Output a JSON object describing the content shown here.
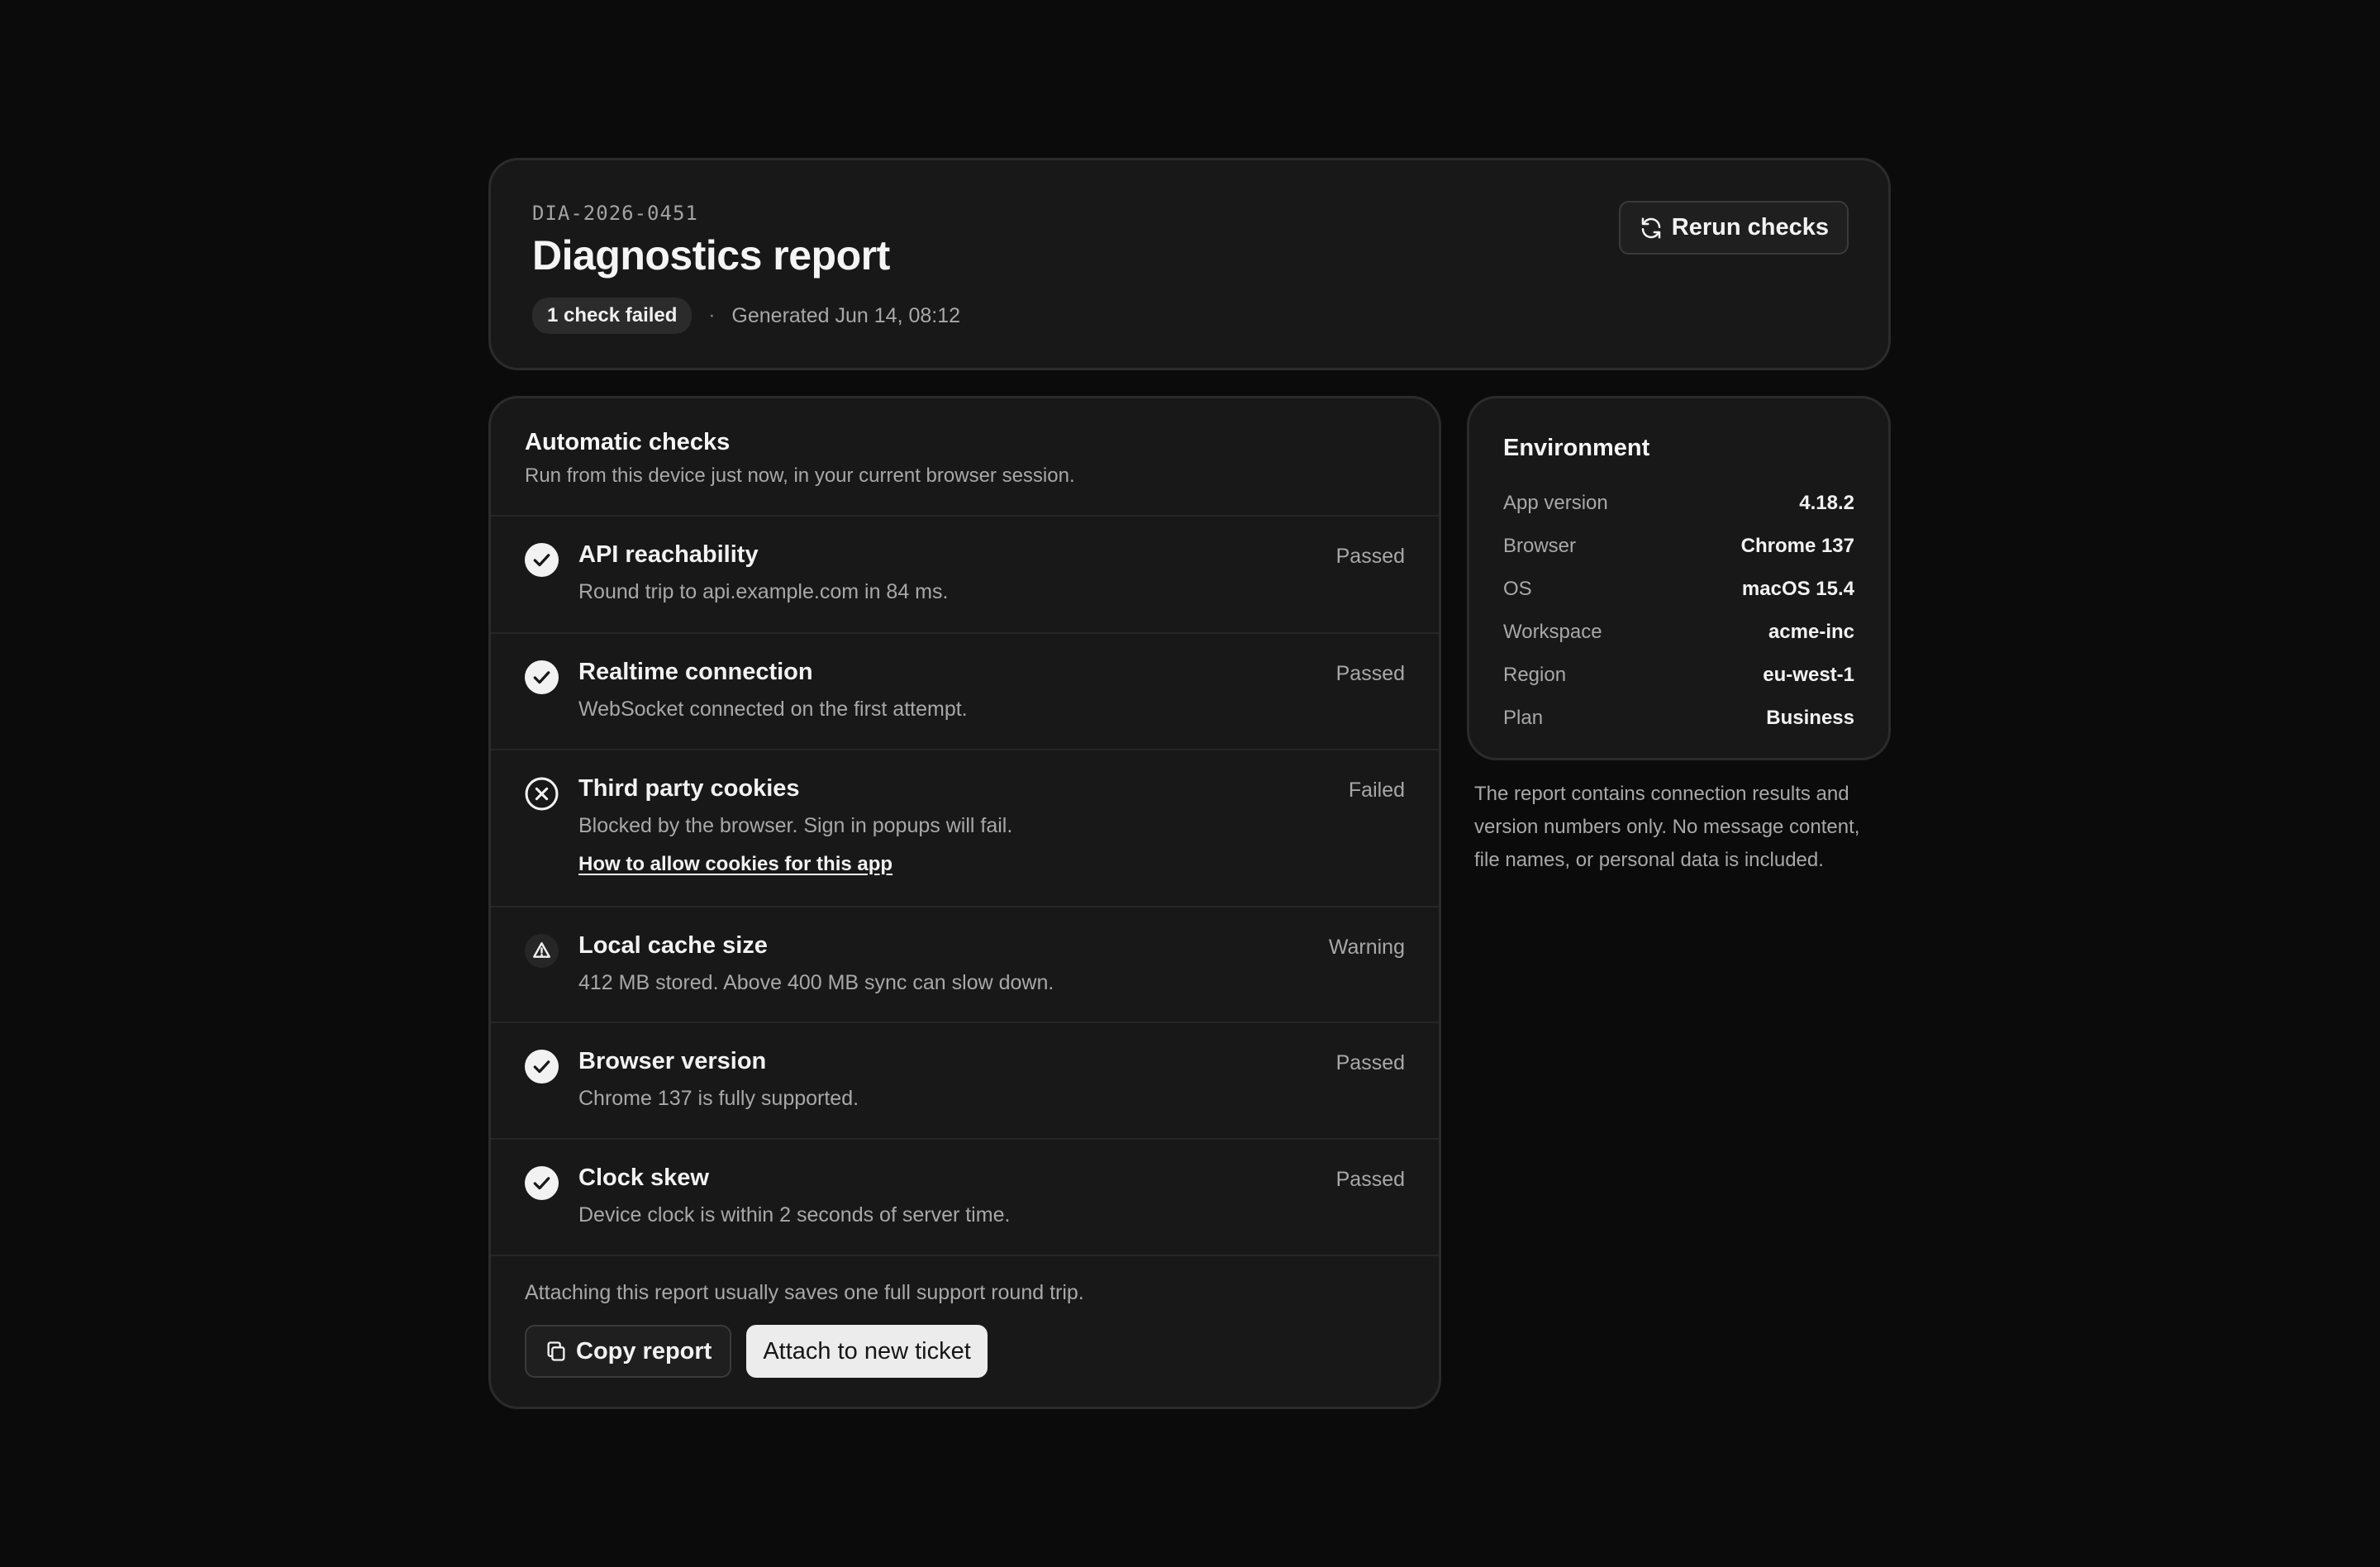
{
  "header": {
    "report_id": "DIA-2026-0451",
    "title": "Diagnostics report",
    "badge": "1 check failed",
    "separator": "·",
    "generated": "Generated Jun 14, 08:12",
    "rerun_label": "Rerun checks",
    "rerun_icon": "refresh-icon"
  },
  "checks": {
    "title": "Automatic checks",
    "subtitle": "Run from this device just now, in your current browser session.",
    "items": [
      {
        "name": "API reachability",
        "desc": "Round trip to api.example.com in 84 ms.",
        "status": "Passed",
        "icon": "check-circle-icon"
      },
      {
        "name": "Realtime connection",
        "desc": "WebSocket connected on the first attempt.",
        "status": "Passed",
        "icon": "check-circle-icon"
      },
      {
        "name": "Third party cookies",
        "desc": "Blocked by the browser. Sign in popups will fail.",
        "status": "Failed",
        "icon": "x-circle-icon",
        "link": "How to allow cookies for this app"
      },
      {
        "name": "Local cache size",
        "desc": "412 MB stored. Above 400 MB sync can slow down.",
        "status": "Warning",
        "icon": "warning-triangle-icon"
      },
      {
        "name": "Browser version",
        "desc": "Chrome 137 is fully supported.",
        "status": "Passed",
        "icon": "check-circle-icon"
      },
      {
        "name": "Clock skew",
        "desc": "Device clock is within 2 seconds of server time.",
        "status": "Passed",
        "icon": "check-circle-icon"
      }
    ],
    "footer_note": "Attaching this report usually saves one full support round trip.",
    "copy_label": "Copy report",
    "copy_icon": "copy-icon",
    "attach_label": "Attach to new ticket"
  },
  "environment": {
    "title": "Environment",
    "rows": [
      {
        "key": "App version",
        "value": "4.18.2"
      },
      {
        "key": "Browser",
        "value": "Chrome 137"
      },
      {
        "key": "OS",
        "value": "macOS 15.4"
      },
      {
        "key": "Workspace",
        "value": "acme-inc"
      },
      {
        "key": "Region",
        "value": "eu-west-1"
      },
      {
        "key": "Plan",
        "value": "Business"
      }
    ]
  },
  "privacy_note": "The report contains connection results and version numbers only. No message content, file names, or personal data is included."
}
